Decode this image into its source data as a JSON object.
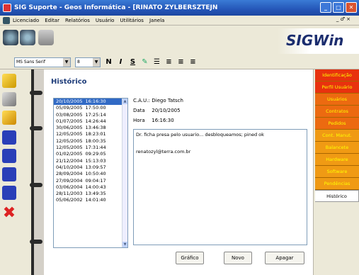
{
  "window": {
    "title": "SIG Suporte - Geos Informática - [RINATO ZYLBERSZTEJN",
    "min": "_",
    "max": "□",
    "close": "✕"
  },
  "menu": {
    "items": [
      "Licenciado",
      "Editar",
      "Relatórios",
      "Usuário",
      "Utilitários",
      "Janela"
    ],
    "mdi_controls": "_ ♂ ×"
  },
  "brand": {
    "text": "SIGWin"
  },
  "format_bar": {
    "font": "MS Sans Serif",
    "size": "8",
    "bold": "N",
    "italic": "I",
    "underline": "S"
  },
  "historico": {
    "title": "Histórico",
    "rows": [
      {
        "date": "20/10/2005",
        "time": "16:16:30"
      },
      {
        "date": "05/09/2005",
        "time": "17:50:00"
      },
      {
        "date": "03/08/2005",
        "time": "17:25:14"
      },
      {
        "date": "01/07/2005",
        "time": "14:26:44"
      },
      {
        "date": "30/06/2005",
        "time": "13:46:38"
      },
      {
        "date": "12/05/2005",
        "time": "18:23:01"
      },
      {
        "date": "12/05/2005",
        "time": "18:00:35"
      },
      {
        "date": "12/05/2005",
        "time": "17:31:44"
      },
      {
        "date": "01/02/2005",
        "time": "09:29:05"
      },
      {
        "date": "21/12/2004",
        "time": "15:13:03"
      },
      {
        "date": "04/10/2004",
        "time": "13:09:57"
      },
      {
        "date": "28/09/2004",
        "time": "10:50:40"
      },
      {
        "date": "27/09/2004",
        "time": "09:04:17"
      },
      {
        "date": "03/06/2004",
        "time": "14:00:43"
      },
      {
        "date": "28/11/2003",
        "time": "13:49:35"
      },
      {
        "date": "05/06/2002",
        "time": "14:01:40"
      }
    ],
    "selected_index": 0,
    "cau_label": "C.A.U.:",
    "cau_value": "Diego Tatsch",
    "date_label": "Data",
    "date_value": "20/10/2005",
    "hora_label": "Hora",
    "hora_value": "16:16:30",
    "memo_line1": "Dr. ficha presa pelo usuario... desbloqueamos; pined ok",
    "memo_line2": "renatozyl@terra.com.br",
    "btn_grafico": "Gráfico",
    "btn_novo": "Novo",
    "btn_apagar": "Apagar"
  },
  "tabs": [
    "Identificação",
    "Perfil Usuário",
    "Usuários",
    "Contratos",
    "Pedidos",
    "Cont. Manut.",
    "Balancete",
    "Hardware",
    "Software",
    "Pendências",
    "Histórico"
  ],
  "tab_colors": {
    "active": "#ffffff",
    "inactive": "#e8420e"
  }
}
